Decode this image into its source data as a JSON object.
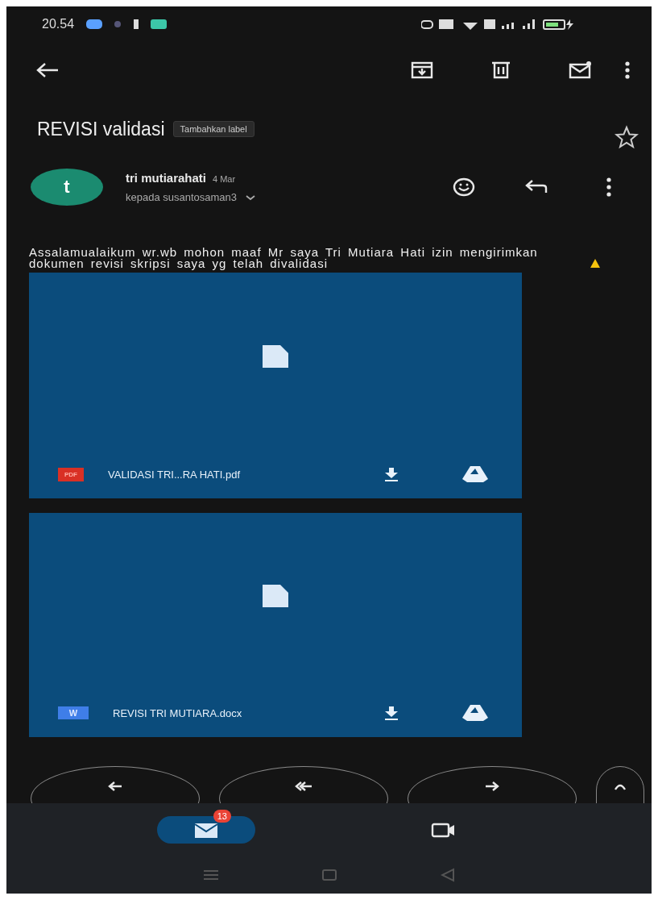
{
  "status_bar": {
    "time": "20.54"
  },
  "subject": {
    "title": "REVISI validasi",
    "label_chip": "Tambahkan label",
    "starred": false
  },
  "message": {
    "avatar_letter": "t",
    "sender": "tri mutiarahati",
    "date": "4 Mar",
    "recipient": "kepada susantosaman3",
    "body": "Assalamualaikum wr.wb mohon maaf Mr saya Tri Mutiara Hati izin mengirimkan dokumen revisi skripsi saya yg telah divalidasi"
  },
  "attachments": [
    {
      "kind": "pdf",
      "badge": "PDF",
      "filename": "VALIDASI TRI...RA HATI.pdf"
    },
    {
      "kind": "docx",
      "badge": "W",
      "filename": "REVISI TRI MUTIARA.docx"
    }
  ],
  "actions": [
    {
      "kind": "reply"
    },
    {
      "kind": "reply_all"
    },
    {
      "kind": "forward"
    },
    {
      "kind": "emoji"
    }
  ],
  "bottom_nav": [
    {
      "kind": "mail",
      "selected": true,
      "badge": "13"
    },
    {
      "kind": "video",
      "selected": false
    }
  ]
}
